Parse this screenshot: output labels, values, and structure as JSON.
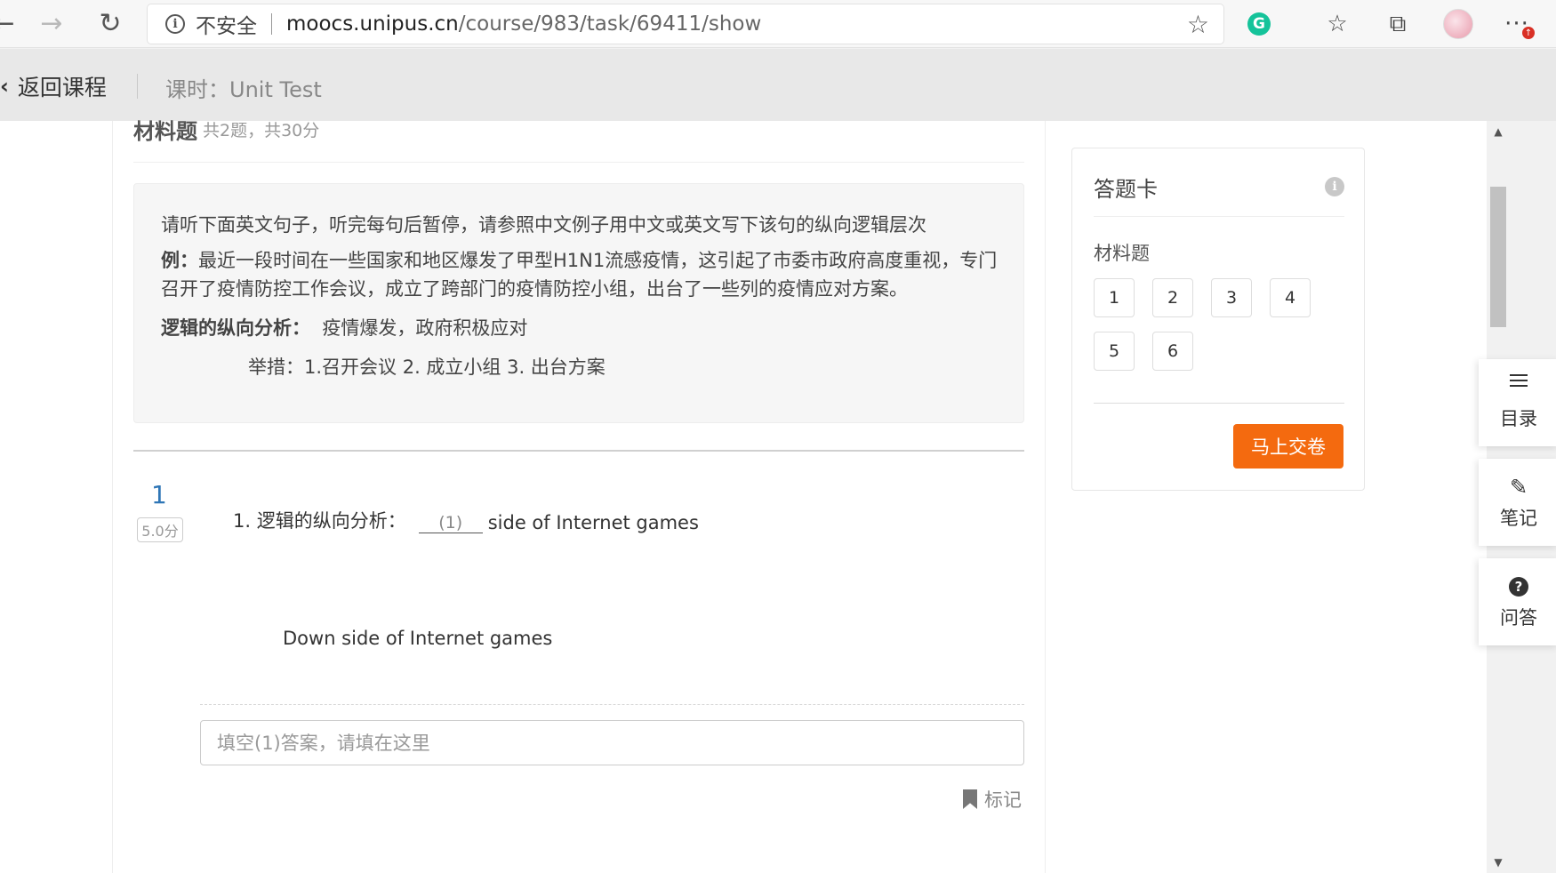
{
  "browser": {
    "back_glyph": "←",
    "forward_glyph": "→",
    "refresh_glyph": "↻",
    "security_label": "不安全",
    "url_host": "moocs.unipus.cn",
    "url_path": "/course/983/task/69411/show",
    "favorite_glyph": "☆",
    "grammarly_letter": "G",
    "favorites_glyph": "☆",
    "collections_glyph": "⧉",
    "more_glyph": "···",
    "update_badge": "↑"
  },
  "header": {
    "back_label": "返回课程",
    "lesson_title": "课时：Unit Test"
  },
  "section": {
    "title": "材料题",
    "meta": "共2题，共30分"
  },
  "instruction": {
    "line1": "请听下面英文句子，听完每句后暂停，请参照中文例子用中文或英文写下该句的纵向逻辑层次",
    "example_label": "例：",
    "example_text_1": "最近一段时间在一些国家和地区爆发了甲型H1N1流感疫情，这引起了市委市政府高度重视，专门",
    "example_text_2": "召开了疫情防控工作会议，成立了跨部门的疫情防控小组，出台了一些列的疫情应对方案。",
    "analysis_label": "逻辑的纵向分析：",
    "analysis_text": "疫情爆发，政府积极应对",
    "measures_text": "举措：1.召开会议 2. 成立小组 3. 出台方案"
  },
  "question": {
    "number": "1",
    "score": "5.0分",
    "stem_prefix": "1. 逻辑的纵向分析：",
    "blank_label": "(1)",
    "stem_suffix": "side of Internet games",
    "sample_text": "Down side of Internet games",
    "input_placeholder": "填空(1)答案，请填在这里",
    "mark_label": "标记"
  },
  "answer_card": {
    "title": "答题卡",
    "info_glyph": "i",
    "section_label": "材料题",
    "questions": [
      "1",
      "2",
      "3",
      "4",
      "5",
      "6"
    ],
    "submit_label": "马上交卷"
  },
  "side_tools": {
    "catalog_label": "目录",
    "notes_label": "笔记",
    "notes_glyph": "✎",
    "qa_label": "问答",
    "qa_glyph": "?"
  },
  "scrollbar": {
    "up_glyph": "▲",
    "down_glyph": "▼"
  }
}
